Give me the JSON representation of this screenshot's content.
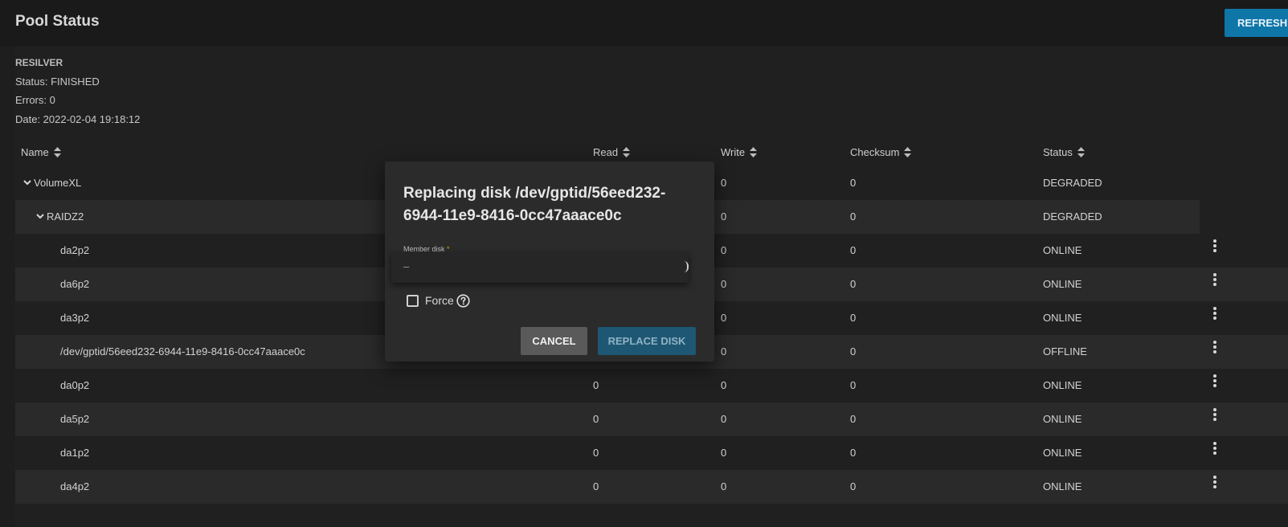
{
  "header": {
    "title": "Pool Status",
    "refresh_label": "REFRESH"
  },
  "scan": {
    "heading": "RESILVER",
    "status": "Status: FINISHED",
    "errors": "Errors: 0",
    "date": "Date: 2022-02-04 19:18:12"
  },
  "table": {
    "columns": [
      "Name",
      "Read",
      "Write",
      "Checksum",
      "Status"
    ],
    "rows": [
      {
        "name": "VolumeXL",
        "read": "",
        "write": "0",
        "checksum": "0",
        "status": "DEGRADED"
      },
      {
        "name": "RAIDZ2",
        "read": "",
        "write": "0",
        "checksum": "0",
        "status": "DEGRADED"
      },
      {
        "name": "da2p2",
        "read": "",
        "write": "0",
        "checksum": "0",
        "status": "ONLINE"
      },
      {
        "name": "da6p2",
        "read": "",
        "write": "0",
        "checksum": "0",
        "status": "ONLINE"
      },
      {
        "name": "da3p2",
        "read": "",
        "write": "0",
        "checksum": "0",
        "status": "ONLINE"
      },
      {
        "name": "/dev/gptid/56eed232-6944-11e9-8416-0cc47aaace0c",
        "read": "",
        "write": "0",
        "checksum": "0",
        "status": "OFFLINE"
      },
      {
        "name": "da0p2",
        "read": "0",
        "write": "0",
        "checksum": "0",
        "status": "ONLINE"
      },
      {
        "name": "da5p2",
        "read": "0",
        "write": "0",
        "checksum": "0",
        "status": "ONLINE"
      },
      {
        "name": "da1p2",
        "read": "0",
        "write": "0",
        "checksum": "0",
        "status": "ONLINE"
      },
      {
        "name": "da4p2",
        "read": "0",
        "write": "0",
        "checksum": "0",
        "status": "ONLINE"
      }
    ]
  },
  "dialog": {
    "title": "Replacing disk /dev/gptid/56eed232-6944-11e9-8416-0cc47aaace0c",
    "member_label": "Member disk",
    "required_mark": "*",
    "member_value": "–",
    "force_label": "Force",
    "cancel_label": "CANCEL",
    "replace_label": "REPLACE DISK"
  },
  "colors": {
    "accent": "#0f76a8",
    "background": "#1e1e1e",
    "row_alt": "#2a2a2a",
    "required": "#e0a100"
  },
  "icons": [
    "sort-icon",
    "chevron-down-icon",
    "more-vert-icon",
    "help-icon",
    "checkbox-icon"
  ]
}
